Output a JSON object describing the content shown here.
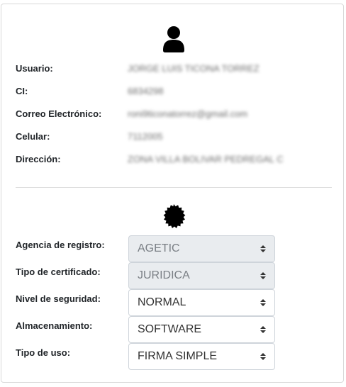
{
  "user_section": {
    "icon": "user-icon",
    "fields": [
      {
        "label": "Usuario:",
        "value": "JORGE LUIS TICONA TORREZ"
      },
      {
        "label": "CI:",
        "value": "6834298"
      },
      {
        "label": "Correo Electrónico:",
        "value": "roni9ticonatorrez@gmail.com"
      },
      {
        "label": "Celular:",
        "value": "7112005"
      },
      {
        "label": "Dirección:",
        "value": "ZONA VILLA BOLIVAR PEDREGAL C"
      }
    ]
  },
  "certificate_section": {
    "icon": "certificate-seal-icon",
    "fields": [
      {
        "label": "Agencia de registro:",
        "value": "AGETIC",
        "disabled": true
      },
      {
        "label": "Tipo de certificado:",
        "value": "JURIDICA",
        "disabled": true
      },
      {
        "label": "Nivel de seguridad:",
        "value": "NORMAL",
        "disabled": false
      },
      {
        "label": "Almacenamiento:",
        "value": "SOFTWARE",
        "disabled": false
      },
      {
        "label": "Tipo de uso:",
        "value": "FIRMA SIMPLE",
        "disabled": false
      }
    ]
  }
}
